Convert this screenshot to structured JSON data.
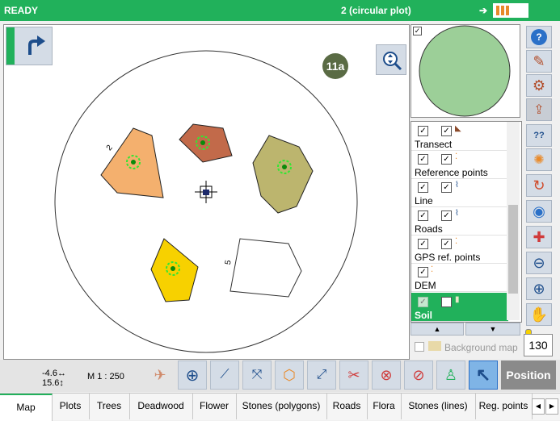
{
  "status": {
    "text": "READY",
    "plot_title": "2 (circular plot)",
    "arrow": "➔"
  },
  "map": {
    "plot_id": "11a",
    "labels": {
      "poly_left": "2",
      "poly_white": "5"
    }
  },
  "layers": [
    {
      "name": "Transect",
      "checked1": true,
      "checked2": true,
      "selected": false
    },
    {
      "name": "Reference points",
      "checked1": true,
      "checked2": true,
      "selected": false
    },
    {
      "name": "Line",
      "checked1": true,
      "checked2": true,
      "selected": false
    },
    {
      "name": "Roads",
      "checked1": true,
      "checked2": true,
      "selected": false
    },
    {
      "name": "GPS ref. points",
      "checked1": true,
      "checked2": true,
      "selected": false
    },
    {
      "name": "DEM",
      "checked1": true,
      "checked2": false,
      "selected": false
    },
    {
      "name": "Soil",
      "checked1": true,
      "checked2": false,
      "selected": true
    }
  ],
  "background_map": {
    "label": "Background map",
    "checked": false
  },
  "zoom_value": "130",
  "coords": {
    "x": "-4.6↔",
    "y": "15.6↕"
  },
  "scale": "M 1 : 250",
  "position_button": "Position",
  "tabs": [
    "Map",
    "Plots",
    "Trees",
    "Deadwood",
    "Flower",
    "Stones (polygons)",
    "Roads",
    "Flora",
    "Stones (lines)",
    "Reg. points"
  ],
  "active_tab": "Map",
  "colors": {
    "accent": "#21b15b",
    "preview_circle": "#9ccf98",
    "poly_orange": "#f4b06e",
    "poly_brown": "#c26a4a",
    "poly_olive": "#bcb56e",
    "poly_yellow": "#f7d100",
    "plot_badge": "#5a6b44"
  }
}
